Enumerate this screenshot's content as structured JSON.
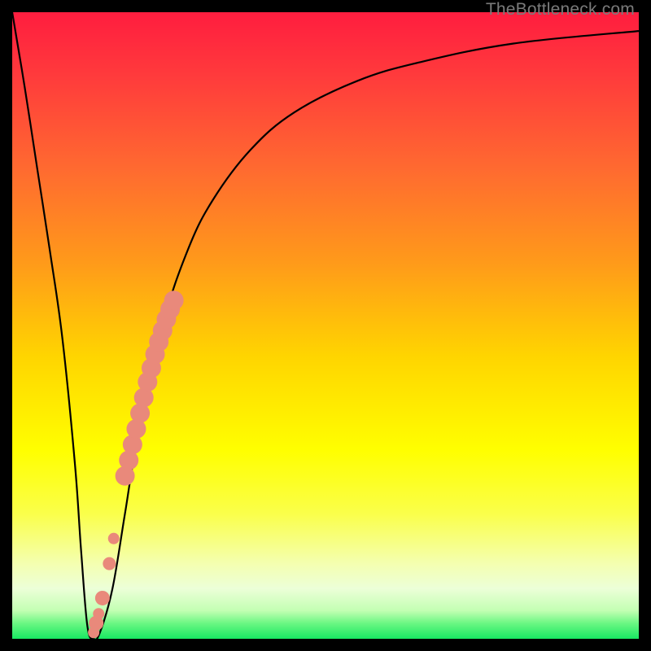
{
  "watermark": "TheBottleneck.com",
  "colors": {
    "frame": "#000000",
    "curve": "#000000",
    "marker_fill": "#e9897b",
    "marker_stroke": "#d06a5c",
    "gradient_stops": [
      {
        "offset": 0.0,
        "color": "#ff1d3f"
      },
      {
        "offset": 0.1,
        "color": "#ff3a3c"
      },
      {
        "offset": 0.25,
        "color": "#ff6a30"
      },
      {
        "offset": 0.4,
        "color": "#ff9a1a"
      },
      {
        "offset": 0.55,
        "color": "#ffd500"
      },
      {
        "offset": 0.7,
        "color": "#ffff00"
      },
      {
        "offset": 0.8,
        "color": "#faff4a"
      },
      {
        "offset": 0.88,
        "color": "#f4ffb0"
      },
      {
        "offset": 0.92,
        "color": "#ecffd8"
      },
      {
        "offset": 0.955,
        "color": "#c3ffb3"
      },
      {
        "offset": 0.975,
        "color": "#6cf783"
      },
      {
        "offset": 1.0,
        "color": "#18e862"
      }
    ]
  },
  "chart_data": {
    "type": "line",
    "title": "",
    "xlabel": "",
    "ylabel": "",
    "xlim": [
      0,
      100
    ],
    "ylim": [
      0,
      100
    ],
    "grid": false,
    "series": [
      {
        "name": "bottleneck-curve",
        "x": [
          0,
          2,
          4,
          6,
          8,
          10,
          11,
          12,
          13,
          14,
          16,
          18,
          20,
          24,
          28,
          32,
          38,
          45,
          55,
          65,
          80,
          100
        ],
        "y": [
          100,
          88,
          75,
          62,
          48,
          28,
          14,
          2,
          0,
          1,
          8,
          20,
          32,
          50,
          62,
          70,
          78,
          84,
          89,
          92,
          95,
          97
        ]
      }
    ],
    "markers": {
      "name": "highlighted-points",
      "x": [
        13.0,
        13.4,
        13.8,
        14.4,
        15.5,
        16.2,
        18.0,
        18.6,
        19.2,
        19.8,
        20.4,
        21.0,
        21.6,
        22.2,
        22.8,
        23.4,
        24.0,
        24.6,
        25.2,
        25.8
      ],
      "y": [
        1.0,
        2.5,
        4.0,
        6.5,
        12.0,
        16.0,
        26.0,
        28.5,
        31.0,
        33.5,
        36.0,
        38.5,
        41.0,
        43.2,
        45.4,
        47.4,
        49.2,
        51.0,
        52.6,
        54.0
      ],
      "r": [
        7,
        9,
        7,
        9,
        8,
        7,
        12,
        12,
        12,
        12,
        12,
        12,
        12,
        12,
        12,
        12,
        12,
        12,
        12,
        12
      ]
    }
  }
}
